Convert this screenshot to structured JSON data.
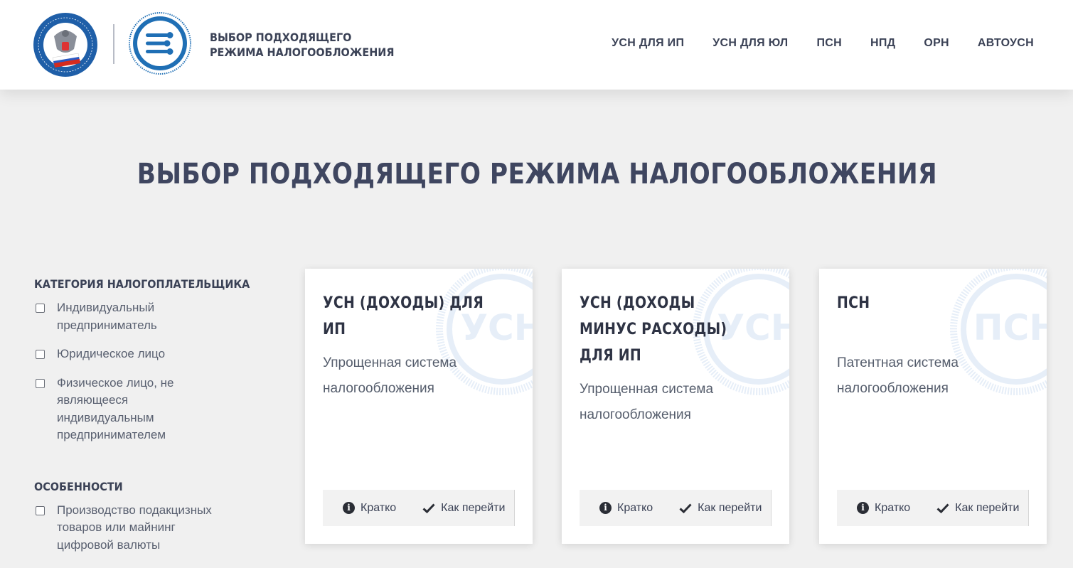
{
  "header": {
    "brand_line1": "ВЫБОР ПОДХОДЯЩЕГО",
    "brand_line2": "РЕЖИМА НАЛОГООБЛОЖЕНИЯ",
    "logo_fns_icon": "fns-emblem-icon",
    "logo_app_icon": "sliders-emblem-icon",
    "nav": [
      "УСН ДЛЯ ИП",
      "УСН ДЛЯ ЮЛ",
      "ПСН",
      "НПД",
      "ОРН",
      "АВТОУСН"
    ]
  },
  "page_title": "ВЫБОР ПОДХОДЯЩЕГО РЕЖИМА НАЛОГООБЛОЖЕНИЯ",
  "sidebar": {
    "category_title": "КАТЕГОРИЯ НАЛОГОПЛАТЕЛЬЩИКА",
    "category_options": [
      "Индивидуальный предприниматель",
      "Юридическое лицо",
      "Физическое лицо, не являющееся индивидуальным предпринимателем"
    ],
    "features_title": "ОСОБЕННОСТИ",
    "features_options": [
      "Производство подакцизных товаров или майнинг цифровой валюты"
    ]
  },
  "cards": [
    {
      "title": "УСН (ДОХОДЫ) ДЛЯ ИП",
      "watermark": "УСН",
      "desc": "Упрощенная система налогообложения",
      "action_info": "Кратко",
      "action_go": "Как перейти"
    },
    {
      "title": "УСН (ДОХОДЫ МИНУС РАСХОДЫ) ДЛЯ ИП",
      "watermark": "УСН",
      "desc": "Упрощенная система налогообложения",
      "action_info": "Кратко",
      "action_go": "Как перейти"
    },
    {
      "title": "ПСН",
      "watermark": "ПСН",
      "desc": "Патентная система налогообложения",
      "action_info": "Кратко",
      "action_go": "Как перейти"
    }
  ],
  "colors": {
    "accent_blue": "#1f6fb5",
    "text_dark": "#3b4256",
    "background": "#f0f0f0"
  }
}
